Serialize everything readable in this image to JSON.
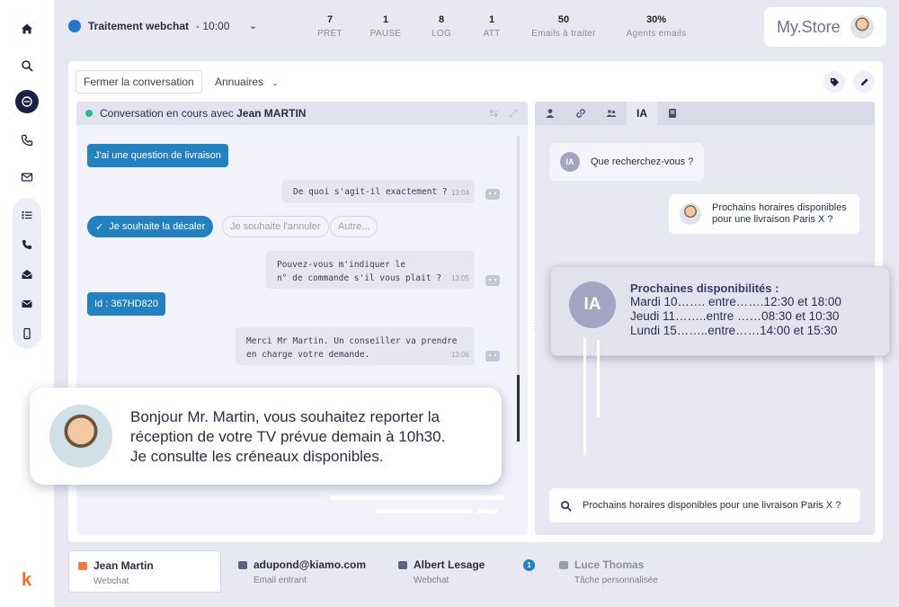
{
  "topbar": {
    "status_title": "Traitement webchat",
    "status_time": "- 10:00",
    "stats": [
      {
        "value": "7",
        "label": "PRET"
      },
      {
        "value": "1",
        "label": "PAUSE"
      },
      {
        "value": "8",
        "label": "LOG"
      },
      {
        "value": "1",
        "label": "ATT"
      },
      {
        "value": "50",
        "label": "Emails à traiter"
      },
      {
        "value": "30%",
        "label": "Agents emails"
      }
    ],
    "store_name": "My.Store"
  },
  "toolbar": {
    "close_label": "Fermer la conversation",
    "annuaires_label": "Annuaires"
  },
  "conversation": {
    "header_prefix": "Conversation en cours avec",
    "header_name": "Jean MARTIN",
    "messages": [
      {
        "text": "J'ai une question de livraison"
      },
      {
        "text": "De quoi s'agit-il exactement ?",
        "time": "13:04"
      },
      {
        "text": "Pouvez-vous m'indiquer le",
        "text2": "n° de commande s'il vous plait ?",
        "time": "13:05"
      },
      {
        "text": "Id : 367HD820"
      },
      {
        "text": "Merci Mr Martin. Un conseiller va prendre",
        "text2": "en charge votre demande.",
        "time": "13:06"
      }
    ],
    "options": [
      "Je souhaite la décaler",
      "Je souhaite l'annuler",
      "Autre..."
    ]
  },
  "ai_panel": {
    "tab_ia": "IA",
    "badge": "IA",
    "question": "Que recherchez-vous ?",
    "user_query_line1": "Prochains horaires disponibles",
    "user_query_line2": "pour une livraison Paris X ?",
    "search_value": "Prochains horaires disponibles pour une livraison Paris X ?"
  },
  "availability": {
    "badge": "IA",
    "title": "Prochaines disponibilités :",
    "lines": [
      "Mardi 10……. entre…….12:30 et 18:00",
      "Jeudi 11……..entre ……08:30 et 10:30",
      "Lundi 15……..entre……14:00 et 15:30"
    ]
  },
  "agent_bubble": {
    "line1": "Bonjour Mr. Martin, vous souhaitez reporter la",
    "line2": "réception de votre TV prévue demain à 10h30.",
    "line3": "Je consulte les créneaux disponibles."
  },
  "bottom_tabs": [
    {
      "name": "Jean Martin",
      "sub": "Webchat"
    },
    {
      "name": "adupond@kiamo.com",
      "sub": "Email entrant"
    },
    {
      "name": "Albert Lesage",
      "sub": "Webchat",
      "badge": "1"
    },
    {
      "name": "Luce Thomas",
      "sub": "Tâche personnalisée"
    }
  ],
  "brand": {
    "logo": "k",
    "accent": "#2580bf",
    "logo_color": "#ff6a2b"
  }
}
